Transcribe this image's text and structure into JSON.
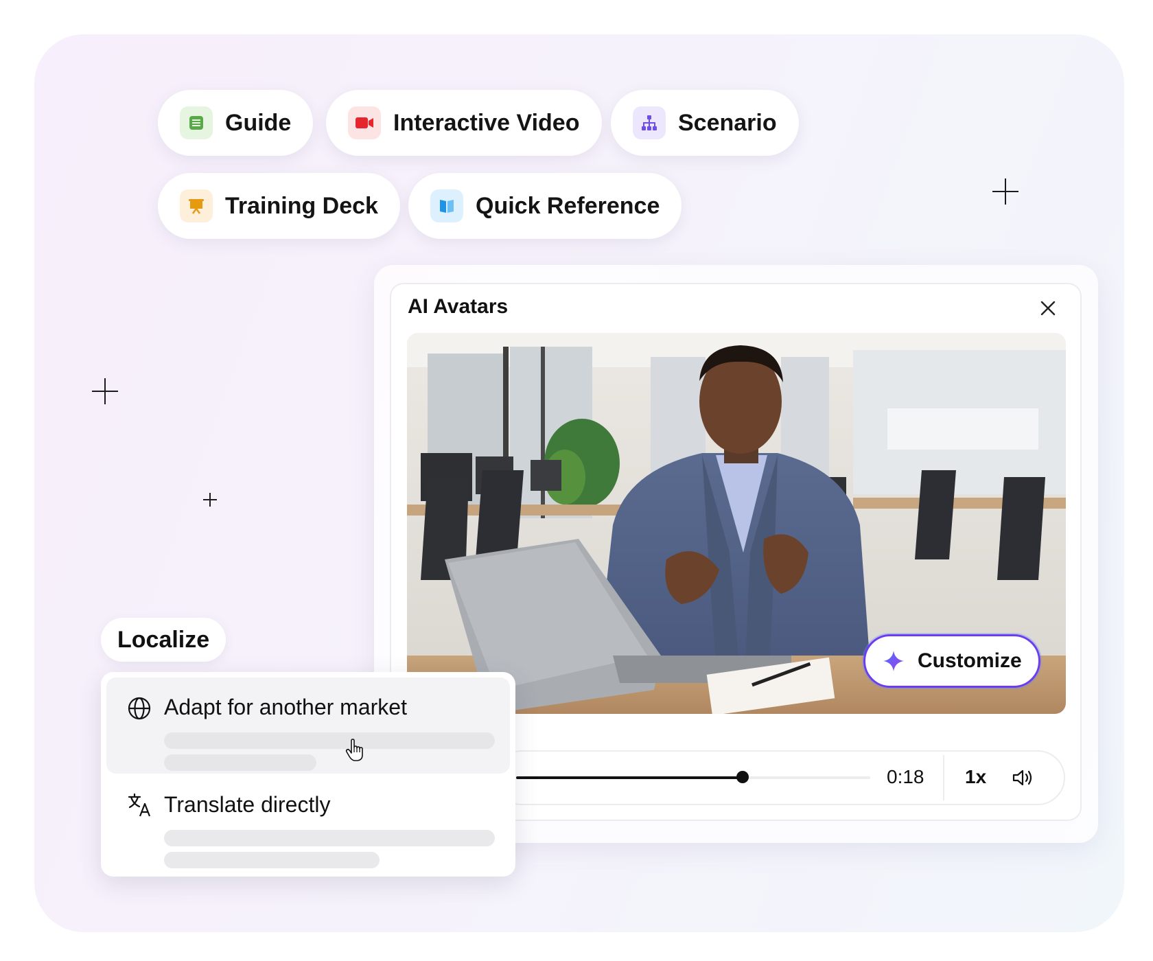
{
  "chips": [
    {
      "label": "Guide",
      "icon": "guide-icon",
      "color": "#5aa84a",
      "bg": "#e6f5df"
    },
    {
      "label": "Interactive Video",
      "icon": "video-camera-icon",
      "color": "#e5262c",
      "bg": "#fde4e4"
    },
    {
      "label": "Scenario",
      "icon": "hierarchy-icon",
      "color": "#6d4ee8",
      "bg": "#ece7fd"
    },
    {
      "label": "Training Deck",
      "icon": "presentation-icon",
      "color": "#e69a12",
      "bg": "#fdefd9"
    },
    {
      "label": "Quick Reference",
      "icon": "book-icon",
      "color": "#1f94e6",
      "bg": "#dcf0fd"
    }
  ],
  "panel": {
    "title": "AI Avatars",
    "customize_label": "Customize",
    "accent": "#6c3df0"
  },
  "player": {
    "time": "0:18",
    "speed": "1x",
    "progress": 0.64
  },
  "localize": {
    "label": "Localize",
    "options": [
      {
        "label": "Adapt for another market",
        "icon": "globe-icon"
      },
      {
        "label": "Translate directly",
        "icon": "translate-icon"
      }
    ]
  }
}
